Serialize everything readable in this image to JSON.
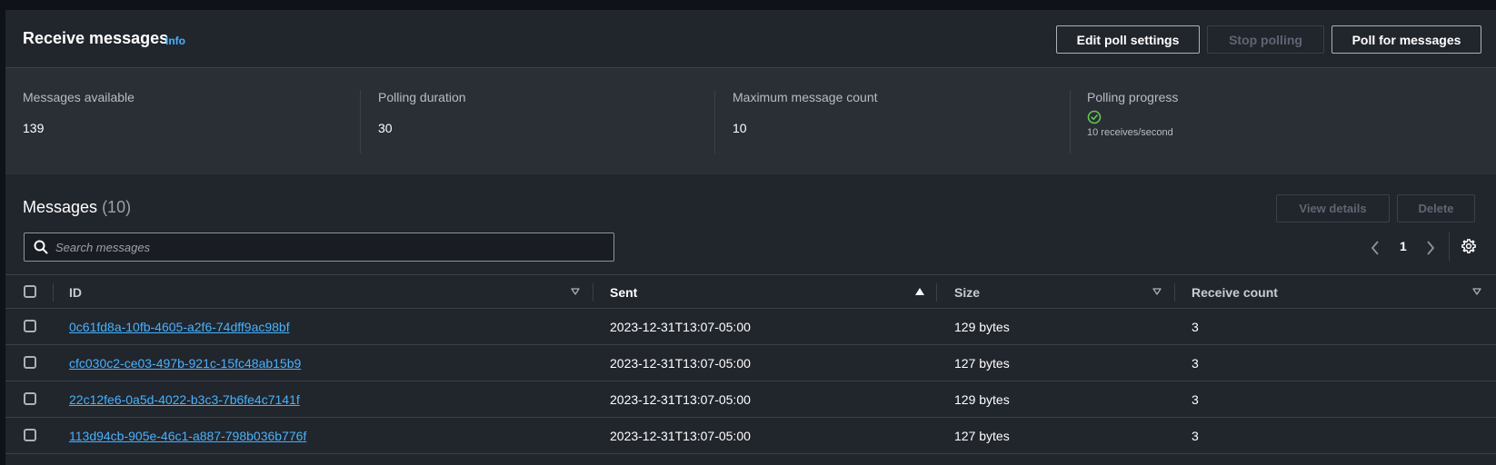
{
  "header": {
    "title": "Receive messages",
    "info": "Info",
    "edit_poll_settings": "Edit poll settings",
    "stop_polling": "Stop polling",
    "poll_for_messages": "Poll for messages"
  },
  "stats": {
    "messages_available_label": "Messages available",
    "messages_available_value": "139",
    "polling_duration_label": "Polling duration",
    "polling_duration_value": "30",
    "max_message_count_label": "Maximum message count",
    "max_message_count_value": "10",
    "polling_progress_label": "Polling progress",
    "polling_progress_sub": "10 receives/second"
  },
  "messages": {
    "title": "Messages",
    "count": "(10)",
    "view_details": "View details",
    "delete": "Delete",
    "search_placeholder": "Search messages",
    "page": "1"
  },
  "table": {
    "headers": {
      "id": "ID",
      "sent": "Sent",
      "size": "Size",
      "receive_count": "Receive count"
    },
    "rows": [
      {
        "id": "0c61fd8a-10fb-4605-a2f6-74dff9ac98bf",
        "sent": "2023-12-31T13:07-05:00",
        "size": "129 bytes",
        "receive_count": "3"
      },
      {
        "id": "cfc030c2-ce03-497b-921c-15fc48ab15b9",
        "sent": "2023-12-31T13:07-05:00",
        "size": "127 bytes",
        "receive_count": "3"
      },
      {
        "id": "22c12fe6-0a5d-4022-b3c3-7b6fe4c7141f",
        "sent": "2023-12-31T13:07-05:00",
        "size": "129 bytes",
        "receive_count": "3"
      },
      {
        "id": "113d94cb-905e-46c1-a887-798b036b776f",
        "sent": "2023-12-31T13:07-05:00",
        "size": "127 bytes",
        "receive_count": "3"
      }
    ]
  },
  "colors": {
    "background": "#21252c",
    "stats_background": "#2a2e35",
    "link": "#42b4ff",
    "success": "#5fc94a"
  }
}
